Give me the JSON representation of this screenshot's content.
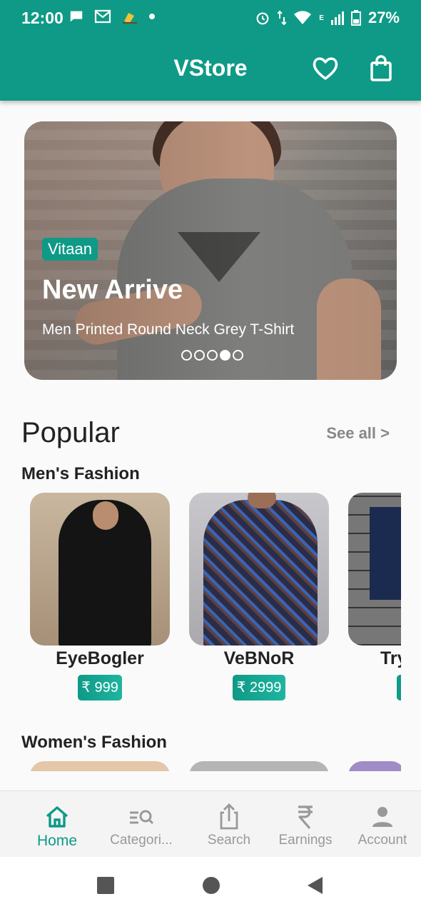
{
  "status_bar": {
    "time": "12:00",
    "battery": "27%",
    "network_label": "E"
  },
  "app_bar": {
    "title": "VStore",
    "favorites_icon": "heart-outline-icon",
    "cart_icon": "shopping-bag-icon"
  },
  "banner": {
    "brand_tag": "Vitaan",
    "headline": "New Arrive",
    "subtitle": "Men Printed Round Neck Grey T-Shirt",
    "slide_count": 5,
    "active_slide": 4
  },
  "popular": {
    "title": "Popular",
    "see_all": "See all >"
  },
  "mens_fashion": {
    "title": "Men's Fashion",
    "products": [
      {
        "name": "EyeBogler",
        "price": "₹ 999"
      },
      {
        "name": "VeBNoR",
        "price": "₹ 2999"
      },
      {
        "name": "Try",
        "price": "₹"
      }
    ]
  },
  "womens_fashion": {
    "title": "Women's Fashion"
  },
  "bottom_nav": {
    "items": [
      {
        "label": "Home",
        "icon": "home-icon",
        "active": true
      },
      {
        "label": "Categori...",
        "icon": "category-search-icon",
        "active": false
      },
      {
        "label": "Search",
        "icon": "share-icon",
        "active": false
      },
      {
        "label": "Earnings",
        "icon": "rupee-icon",
        "active": false
      },
      {
        "label": "Account",
        "icon": "person-icon",
        "active": false
      }
    ]
  },
  "colors": {
    "primary": "#0e9a86",
    "inactive_nav": "#999999"
  }
}
